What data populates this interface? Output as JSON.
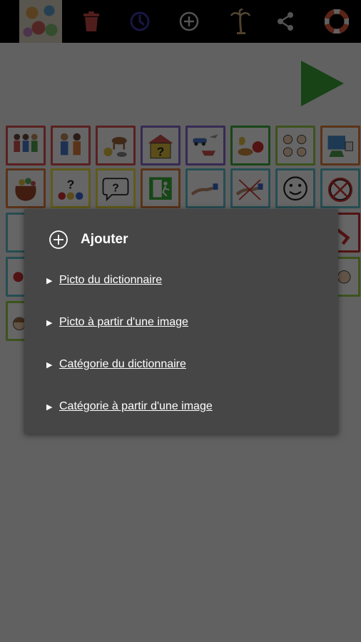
{
  "toolbar": {
    "buttons": [
      {
        "icon": "trash-icon",
        "color": "#c84a4a"
      },
      {
        "icon": "clock-icon",
        "color": "#3a3ab0"
      },
      {
        "icon": "plus-circle-icon",
        "color": "#cfcfcf"
      },
      {
        "icon": "palm-tree-icon",
        "color": "#c8a070"
      },
      {
        "icon": "share-icon",
        "color": "#cfcfcf"
      },
      {
        "icon": "lifebuoy-icon",
        "color": "#e05a3a"
      }
    ]
  },
  "play_button": {
    "icon": "play-icon",
    "color": "#3aa83a"
  },
  "dialog": {
    "title": "Ajouter",
    "icon": "plus-circle-icon",
    "options": [
      {
        "label": "Picto du dictionnaire"
      },
      {
        "label": "Picto à partir d'une image"
      },
      {
        "label": "Catégorie du dictionnaire"
      },
      {
        "label": "Catégorie à partir d'une image"
      }
    ]
  },
  "pictograms": [
    {
      "caption": "",
      "border": "#e05050",
      "art": "people-icon"
    },
    {
      "caption": "",
      "border": "#e05050",
      "art": "people-icon"
    },
    {
      "caption": "",
      "border": "#e05050",
      "art": "animals-icon"
    },
    {
      "caption": "",
      "border": "#8a6ad0",
      "art": "question-house-icon"
    },
    {
      "caption": "",
      "border": "#8a6ad0",
      "art": "vehicles-icon"
    },
    {
      "caption": "",
      "border": "#3ab03a",
      "art": "food-icon"
    },
    {
      "caption": "",
      "border": "#9ad04a",
      "art": "faces-icon"
    },
    {
      "caption": "",
      "border": "#e08040",
      "art": "school-icon"
    },
    {
      "caption": "",
      "border": "#e08040",
      "art": "sack-icon"
    },
    {
      "caption": "",
      "border": "#f0e040",
      "art": "question-colors-icon"
    },
    {
      "caption": "",
      "border": "#f0e040",
      "art": "speech-question-icon"
    },
    {
      "caption": "",
      "border": "#e08040",
      "art": "exit-sign-icon"
    },
    {
      "caption": "",
      "border": "#60c0d0",
      "art": "hand-icon"
    },
    {
      "caption": "",
      "border": "#60c0d0",
      "art": "hand-cross-icon"
    },
    {
      "caption": "",
      "border": "#60c0d0",
      "art": "smiley-icon"
    },
    {
      "caption": "",
      "border": "#60c0d0",
      "art": "no-face-icon"
    }
  ]
}
